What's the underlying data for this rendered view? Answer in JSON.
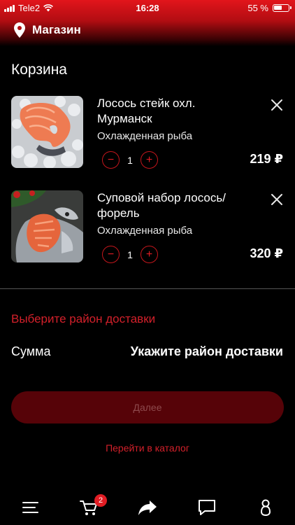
{
  "status_bar": {
    "carrier": "Tele2",
    "time": "16:28",
    "battery": "55 %"
  },
  "header": {
    "title": "Магазин"
  },
  "page": {
    "title": "Корзина"
  },
  "cart": {
    "items": [
      {
        "name": "Лосось стейк охл. Мурманск",
        "category": "Охлажденная рыба",
        "quantity": "1",
        "price": "219 ₽",
        "image_icon": "salmon-steak-photo"
      },
      {
        "name": "Суповой набор лосось/форель",
        "category": "Охлажденная рыба",
        "quantity": "1",
        "price": "320 ₽",
        "image_icon": "soup-set-photo"
      }
    ],
    "minus_label": "−",
    "plus_label": "+"
  },
  "delivery": {
    "choose_label": "Выберите район доставки"
  },
  "summary": {
    "label": "Сумма",
    "value": "Укажите район доставки"
  },
  "actions": {
    "next_label": "Далее",
    "catalog_link": "Перейти в каталог"
  },
  "tabbar": {
    "items": [
      {
        "icon": "menu-icon"
      },
      {
        "icon": "cart-icon",
        "badge": "2"
      },
      {
        "icon": "share-icon"
      },
      {
        "icon": "chat-icon"
      },
      {
        "icon": "profile-icon"
      }
    ]
  },
  "colors": {
    "accent": "#e11d24",
    "header_red": "#e2151b",
    "button_bg": "#560308",
    "background": "#000000"
  }
}
